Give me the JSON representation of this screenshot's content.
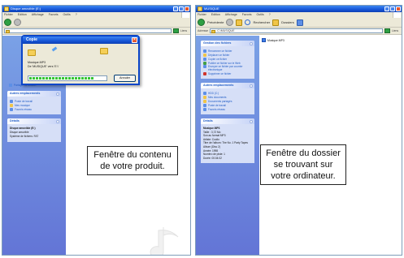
{
  "left_window": {
    "title": "Disque amovible (E:)",
    "menu": [
      "Fichier",
      "Edition",
      "Affichage",
      "Favoris",
      "Outils",
      "?"
    ],
    "share_folder_label": "Partager ce dossier",
    "dialog": {
      "title": "Copie",
      "file_line": "Musique.MP3",
      "dest_line": "De 'MUSIQUE' vers 'E:\\'",
      "progress": 0.85,
      "cancel_label": "Annuler"
    },
    "other_places": {
      "header": "Autres emplacements",
      "items": [
        "Poste de travail",
        "Mes musique",
        "Favoris réseau"
      ]
    },
    "details": {
      "header": "Détails",
      "name": "Disque amovible (E:)",
      "type": "Disque amovible",
      "fs": "Système de fichiers: FAT"
    },
    "caption": "Fenêtre du contenu de votre produit."
  },
  "right_window": {
    "title": "MUSIQUE",
    "menu": [
      "Fichier",
      "Edition",
      "Affichage",
      "Favoris",
      "Outils",
      "?"
    ],
    "toolbar": {
      "back_label": "Précédente",
      "search_label": "Rechercher",
      "folders_label": "Dossiers"
    },
    "address": {
      "label": "Adresse",
      "value": "C:\\MUSIQUE",
      "links_label": "Liens"
    },
    "file_tasks": {
      "header": "Gestion des fichiers",
      "items": [
        "Renommer ce fichier",
        "Déplacer ce fichier",
        "Copier ce fichier",
        "Publier ce fichier sur le Web",
        "Envoyer ce fichier par courrier électronique",
        "Supprimer ce fichier"
      ]
    },
    "other_places": {
      "header": "Autres emplacements",
      "items": [
        "HDD (C:)",
        "Mes documents",
        "Documents partagés",
        "Poste de travail",
        "Favoris réseau"
      ]
    },
    "details": {
      "header": "Détails",
      "lines": [
        "Musique.MP3",
        "Taille : 3,72 Mo",
        "Son au format MP3",
        "Artiste: Coolio",
        "Titre de l'album: The No. 1 Party Tapes Album (Disc 2)",
        "Année: 1998",
        "Numéro de piste: 1",
        "Durée: 00:04:02"
      ]
    },
    "file_item": "Musique.MP3",
    "caption": "Fenêtre du dossier se trouvant sur votre ordinateur."
  }
}
